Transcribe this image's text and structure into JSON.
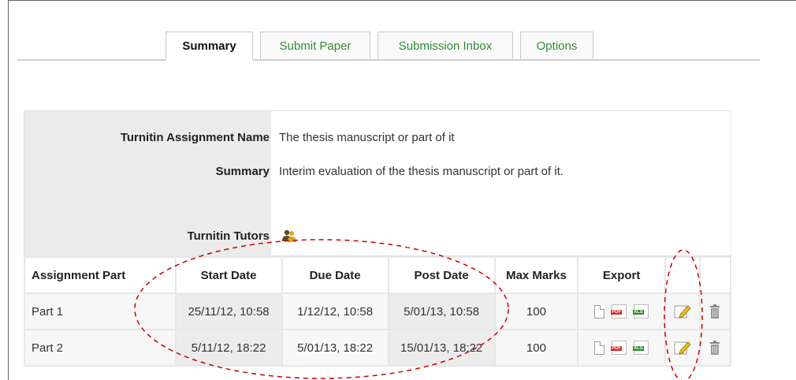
{
  "tabs": [
    {
      "label": "Summary"
    },
    {
      "label": "Submit Paper"
    },
    {
      "label": "Submission Inbox"
    },
    {
      "label": "Options"
    }
  ],
  "info": {
    "name_label": "Turnitin Assignment Name",
    "name_value": "The thesis manuscript or part of it",
    "summary_label": "Summary",
    "summary_value": "Interim evaluation of the thesis manuscript or part of it.",
    "tutors_label": "Turnitin Tutors"
  },
  "table": {
    "headers": [
      "Assignment Part",
      "Start Date",
      "Due Date",
      "Post Date",
      "Max Marks",
      "Export"
    ],
    "rows": [
      {
        "part": "Part 1",
        "start": "25/11/12, 10:58",
        "due": "1/12/12, 10:58",
        "post": "5/01/13, 10:58",
        "max": "100"
      },
      {
        "part": "Part 2",
        "start": "5/11/12, 18:22",
        "due": "5/01/13, 18:22",
        "post": "15/01/13, 18:22",
        "max": "100"
      }
    ]
  },
  "icons": {
    "tutors": "tutors-icon",
    "export": [
      "document-icon",
      "pdf-icon",
      "xls-icon"
    ],
    "edit": "edit-icon",
    "delete": "trash-icon"
  },
  "colors": {
    "tab_link": "#2e8b2e",
    "annotation": "#cc0000",
    "label_bg": "#ebebeb"
  }
}
